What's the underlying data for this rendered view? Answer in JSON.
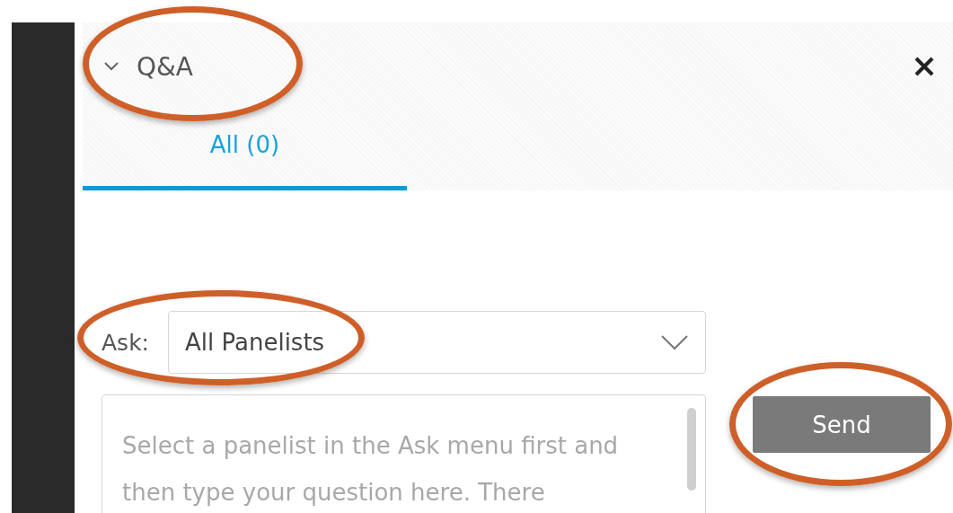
{
  "panel": {
    "title": "Q&A",
    "expanded": true
  },
  "tabs": [
    {
      "label": "All (0)",
      "selected": true
    }
  ],
  "ask": {
    "label": "Ask:",
    "value": "All Panelists"
  },
  "question": {
    "placeholder": "Select a panelist in the Ask menu first and then type your question here. There"
  },
  "send_button": {
    "label": "Send"
  }
}
